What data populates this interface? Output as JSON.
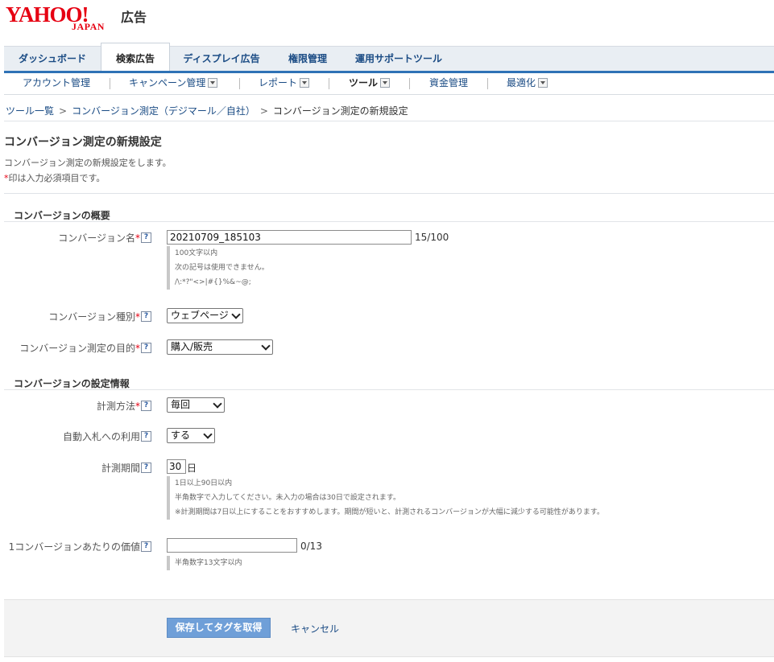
{
  "header": {
    "logo_main": "YAHOO!",
    "logo_sub": "JAPAN",
    "logo_product": "広告"
  },
  "tabs": [
    "ダッシュボード",
    "検索広告",
    "ディスプレイ広告",
    "権限管理",
    "運用サポートツール"
  ],
  "subnav": [
    "アカウント管理",
    "キャンペーン管理",
    "レポート",
    "ツール",
    "資金管理",
    "最適化"
  ],
  "breadcrumb": {
    "item1": "ツール一覧",
    "item2": "コンバージョン測定（デジマール／自社）",
    "current": "コンバージョン測定の新規設定",
    "sep": ">"
  },
  "page": {
    "title": "コンバージョン測定の新規設定",
    "description": "コンバージョン測定の新規設定をします。",
    "required_mark": "*",
    "required_note": "印は入力必須項目です。"
  },
  "section1": {
    "title": "コンバージョンの概要",
    "name_label": "コンバージョン名",
    "name_value": "20210709_185103",
    "name_count": "15/100",
    "name_notes": [
      "100文字以内",
      "次の記号は使用できません。",
      "/\\:*?\"<>|#{}%&~@;"
    ],
    "type_label": "コンバージョン種別",
    "type_value": "ウェブページ",
    "purpose_label": "コンバージョン測定の目的",
    "purpose_value": "購入/販売"
  },
  "section2": {
    "title": "コンバージョンの設定情報",
    "method_label": "計測方法",
    "method_value": "毎回",
    "autobid_label": "自動入札への利用",
    "autobid_value": "する",
    "period_label": "計測期間",
    "period_value": "30",
    "period_unit": "日",
    "period_notes": [
      "1日以上90日以内",
      "半角数字で入力してください。未入力の場合は30日で設定されます。",
      "※計測期間は7日以上にすることをおすすめします。期間が短いと、計測されるコンバージョンが大幅に減少する可能性があります。"
    ],
    "value_label": "1コンバージョンあたりの価値",
    "value_value": "",
    "value_count": "0/13",
    "value_note": "半角数字13文字以内"
  },
  "help_mark": "?",
  "footer": {
    "save_label": "保存してタグを取得",
    "cancel_label": "キャンセル"
  }
}
